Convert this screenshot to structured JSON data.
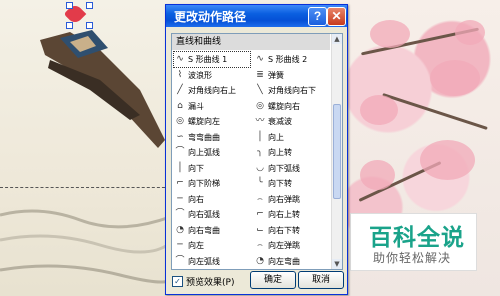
{
  "dialog": {
    "title": "更改动作路径",
    "help_label": "?",
    "close_label": "✕",
    "group_header": "直线和曲线",
    "items": [
      {
        "icon": "∿",
        "label": "S 形曲线 1",
        "selected": true
      },
      {
        "icon": "∿",
        "label": "S 形曲线 2"
      },
      {
        "icon": "⌇",
        "label": "波浪形"
      },
      {
        "icon": "≣",
        "label": "弹簧"
      },
      {
        "icon": "╱",
        "label": "对角线向右上"
      },
      {
        "icon": "╲",
        "label": "对角线向右下"
      },
      {
        "icon": "⌂",
        "label": "漏斗"
      },
      {
        "icon": "◎",
        "label": "螺旋向右"
      },
      {
        "icon": "◎",
        "label": "螺旋向左"
      },
      {
        "icon": "〰",
        "label": "衰减波"
      },
      {
        "icon": "∽",
        "label": "弯弯曲曲"
      },
      {
        "icon": "│",
        "label": "向上"
      },
      {
        "icon": "⌒",
        "label": "向上弧线"
      },
      {
        "icon": "╮",
        "label": "向上转"
      },
      {
        "icon": "│",
        "label": "向下"
      },
      {
        "icon": "◡",
        "label": "向下弧线"
      },
      {
        "icon": "⌐",
        "label": "向下阶梯"
      },
      {
        "icon": "╰",
        "label": "向下转"
      },
      {
        "icon": "─",
        "label": "向右"
      },
      {
        "icon": "⌢",
        "label": "向右弹跳"
      },
      {
        "icon": "⌒",
        "label": "向右弧线"
      },
      {
        "icon": "⌐",
        "label": "向右上转"
      },
      {
        "icon": "◔",
        "label": "向右弯曲"
      },
      {
        "icon": "⌙",
        "label": "向右下转"
      },
      {
        "icon": "─",
        "label": "向左"
      },
      {
        "icon": "⌢",
        "label": "向左弹跳"
      },
      {
        "icon": "⌒",
        "label": "向左弧线"
      },
      {
        "icon": "◔",
        "label": "向左弯曲"
      }
    ],
    "preview_label": "预览效果(P)",
    "preview_checked": true,
    "ok_label": "确定",
    "cancel_label": "取消"
  },
  "watermark": {
    "title": "百科全说",
    "subtitle": "助你轻松解决"
  }
}
